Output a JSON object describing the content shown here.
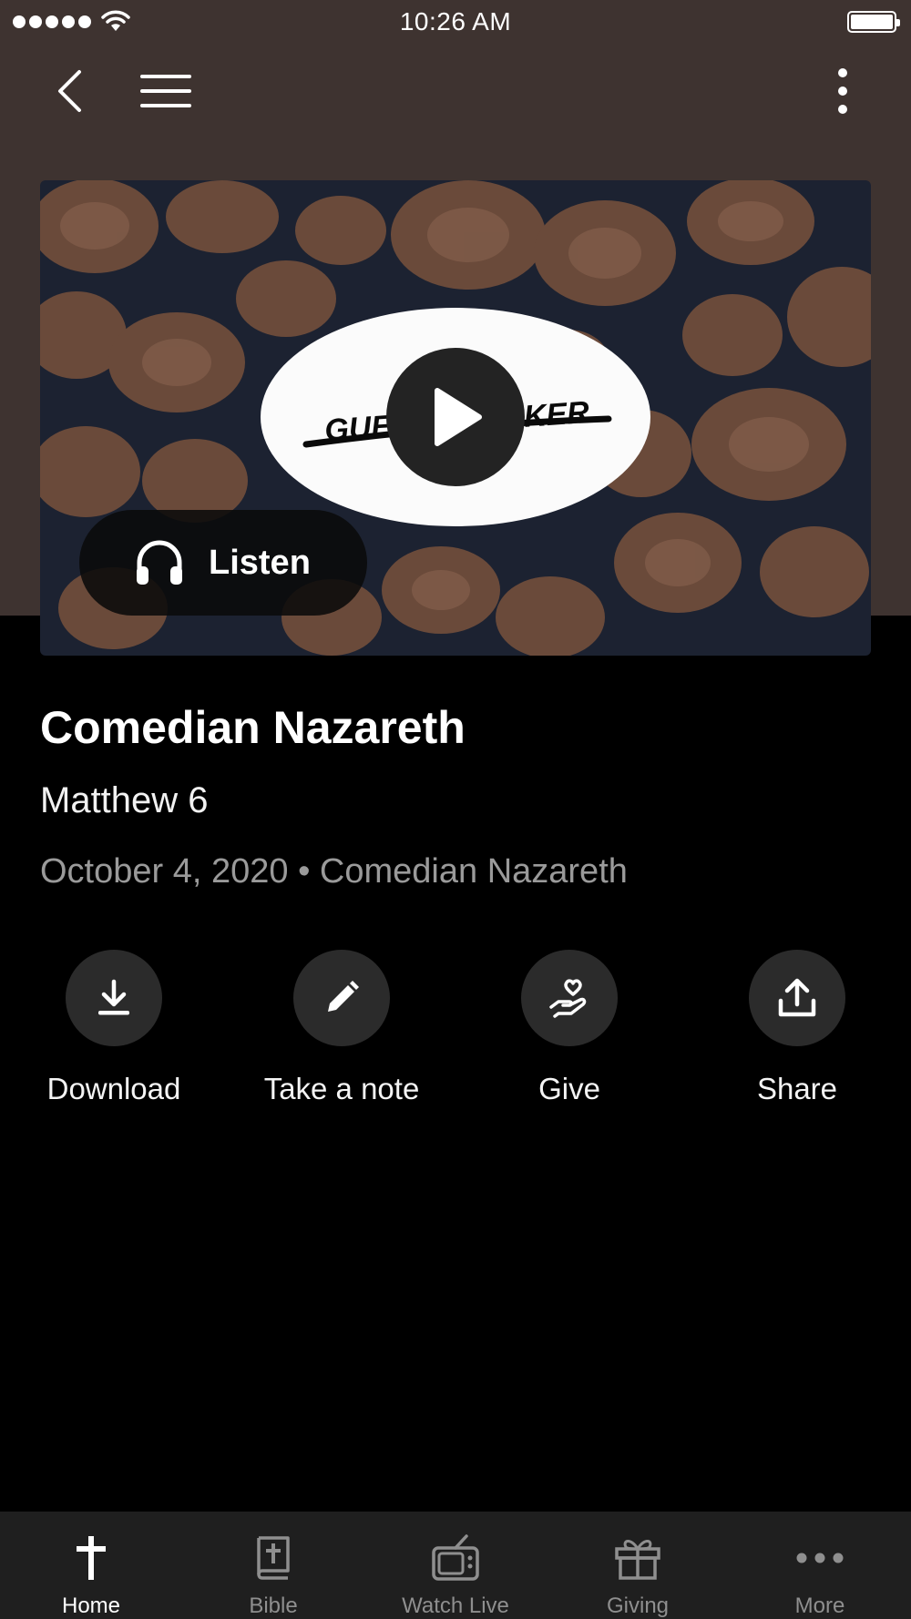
{
  "status_bar": {
    "time": "10:26 AM"
  },
  "hero": {
    "listen_label": "Listen",
    "artwork_text": "GUEST SPEAKER"
  },
  "sermon": {
    "title": "Comedian Nazareth",
    "scripture": "Matthew 6",
    "meta": "October 4, 2020 • Comedian Nazareth"
  },
  "actions": [
    {
      "label": "Download",
      "icon": "download-icon"
    },
    {
      "label": "Take a note",
      "icon": "pencil-icon"
    },
    {
      "label": "Give",
      "icon": "heart-hand-icon"
    },
    {
      "label": "Share",
      "icon": "share-icon"
    }
  ],
  "tabs": [
    {
      "label": "Home",
      "icon": "cross-icon",
      "active": true
    },
    {
      "label": "Bible",
      "icon": "bible-icon",
      "active": false
    },
    {
      "label": "Watch Live",
      "icon": "tv-icon",
      "active": false
    },
    {
      "label": "Giving",
      "icon": "gift-icon",
      "active": false
    },
    {
      "label": "More",
      "icon": "more-dots-icon",
      "active": false
    }
  ],
  "colors": {
    "header_bg": "#3e3330",
    "page_bg": "#000000",
    "tabbar_bg": "#1f1f1f",
    "action_circle": "#2b2b2b",
    "meta_text": "#9a9a9a"
  }
}
